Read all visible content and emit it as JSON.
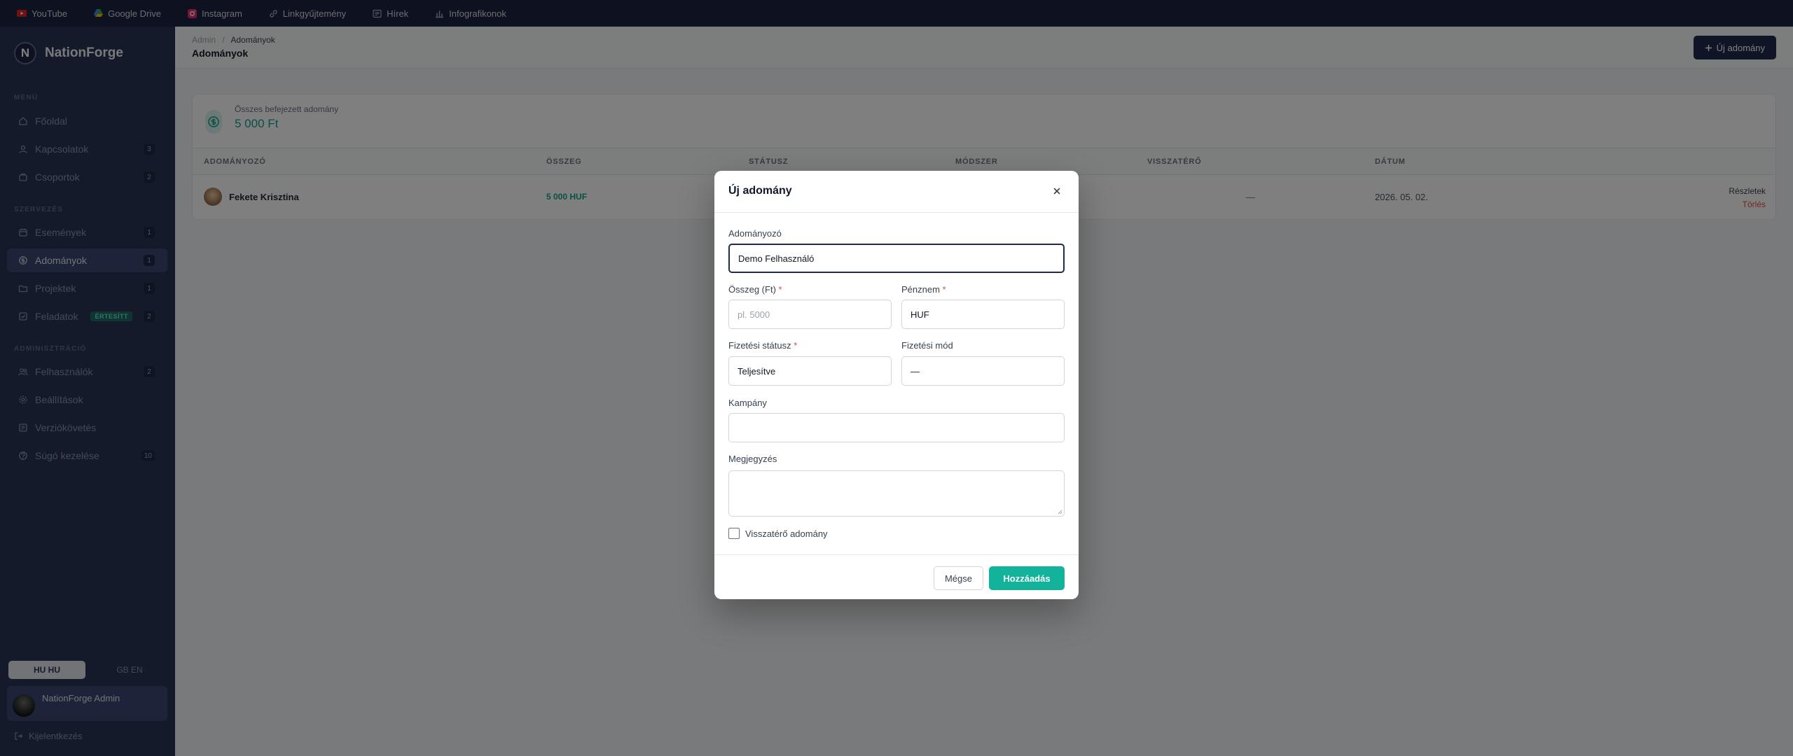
{
  "bookmarks": [
    {
      "label": "YouTube",
      "icon": "youtube-icon",
      "color": "#e02424"
    },
    {
      "label": "Google Drive",
      "icon": "google-drive-icon",
      "color": "#34a853"
    },
    {
      "label": "Instagram",
      "icon": "instagram-icon",
      "color": "#e1306c"
    },
    {
      "label": "Linkgyűjtemény",
      "icon": "link-icon",
      "color": "#aab2c8"
    },
    {
      "label": "Hírek",
      "icon": "news-icon",
      "color": "#aab2c8"
    },
    {
      "label": "Infografikonok",
      "icon": "chart-icon",
      "color": "#aab2c8"
    }
  ],
  "sidebar": {
    "brand": "NationForge",
    "brand_letter": "N",
    "sections": {
      "menu": "MENÜ",
      "organize": "SZERVEZÉS",
      "admin": "ADMINISZTRÁCIÓ"
    },
    "items": [
      {
        "label": "Főoldal",
        "badge": ""
      },
      {
        "label": "Kapcsolatok",
        "badge": "3"
      },
      {
        "label": "Csoportok",
        "badge": "2"
      },
      {
        "label": "Események",
        "badge": "1"
      },
      {
        "label": "Adományok",
        "badge": "1"
      },
      {
        "label": "Projektek",
        "badge": "1"
      },
      {
        "label": "Feladatok",
        "badge": "2",
        "tag": "ÉRTESÍTT"
      },
      {
        "label": "Felhasználók",
        "badge": "2"
      },
      {
        "label": "Beállítások",
        "badge": ""
      },
      {
        "label": "Verziókövetés",
        "badge": ""
      },
      {
        "label": "Súgó kezelése",
        "badge": "10"
      }
    ],
    "lang_hu": "HU HU",
    "lang_en": "GB EN",
    "user_name": "NationForge Admin",
    "logout": "Kijelentkezés"
  },
  "header": {
    "crumb_root": "Admin",
    "crumb_sep": "/",
    "crumb_current": "Adományok",
    "title": "Adományok",
    "new_button": "Új adomány"
  },
  "summary": {
    "label": "Összes befejezett adomány",
    "value": "5 000 Ft"
  },
  "table": {
    "headers": [
      "ADOMÁNYOZÓ",
      "ÖSSZEG",
      "STÁTUSZ",
      "MÓDSZER",
      "VISSZATÉRŐ",
      "DÁTUM"
    ],
    "rows": [
      {
        "donor": "Fekete Krisztina",
        "amount": "5 000 HUF",
        "recurring": "—",
        "date": "2026. 05. 02.",
        "details": "Részletek",
        "delete": "Törlés"
      }
    ]
  },
  "modal": {
    "title": "Új adomány",
    "donor_label": "Adományozó",
    "donor_value": "Demo Felhasználó",
    "amount_label": "Összeg (Ft)",
    "amount_placeholder": "pl. 5000",
    "currency_label": "Pénznem",
    "currency_value": "HUF",
    "status_label": "Fizetési státusz",
    "status_value": "Teljesítve",
    "method_label": "Fizetési mód",
    "method_value": "—",
    "campaign_label": "Kampány",
    "campaign_value": "",
    "note_label": "Megjegyzés",
    "recurring_label": "Visszatérő adomány",
    "required_mark": "*",
    "cancel": "Mégse",
    "submit": "Hozzáadás"
  },
  "colors": {
    "accent": "#12b39a",
    "navy": "#1f2a4d",
    "sidebar": "#2a3557",
    "danger": "#e04848"
  }
}
